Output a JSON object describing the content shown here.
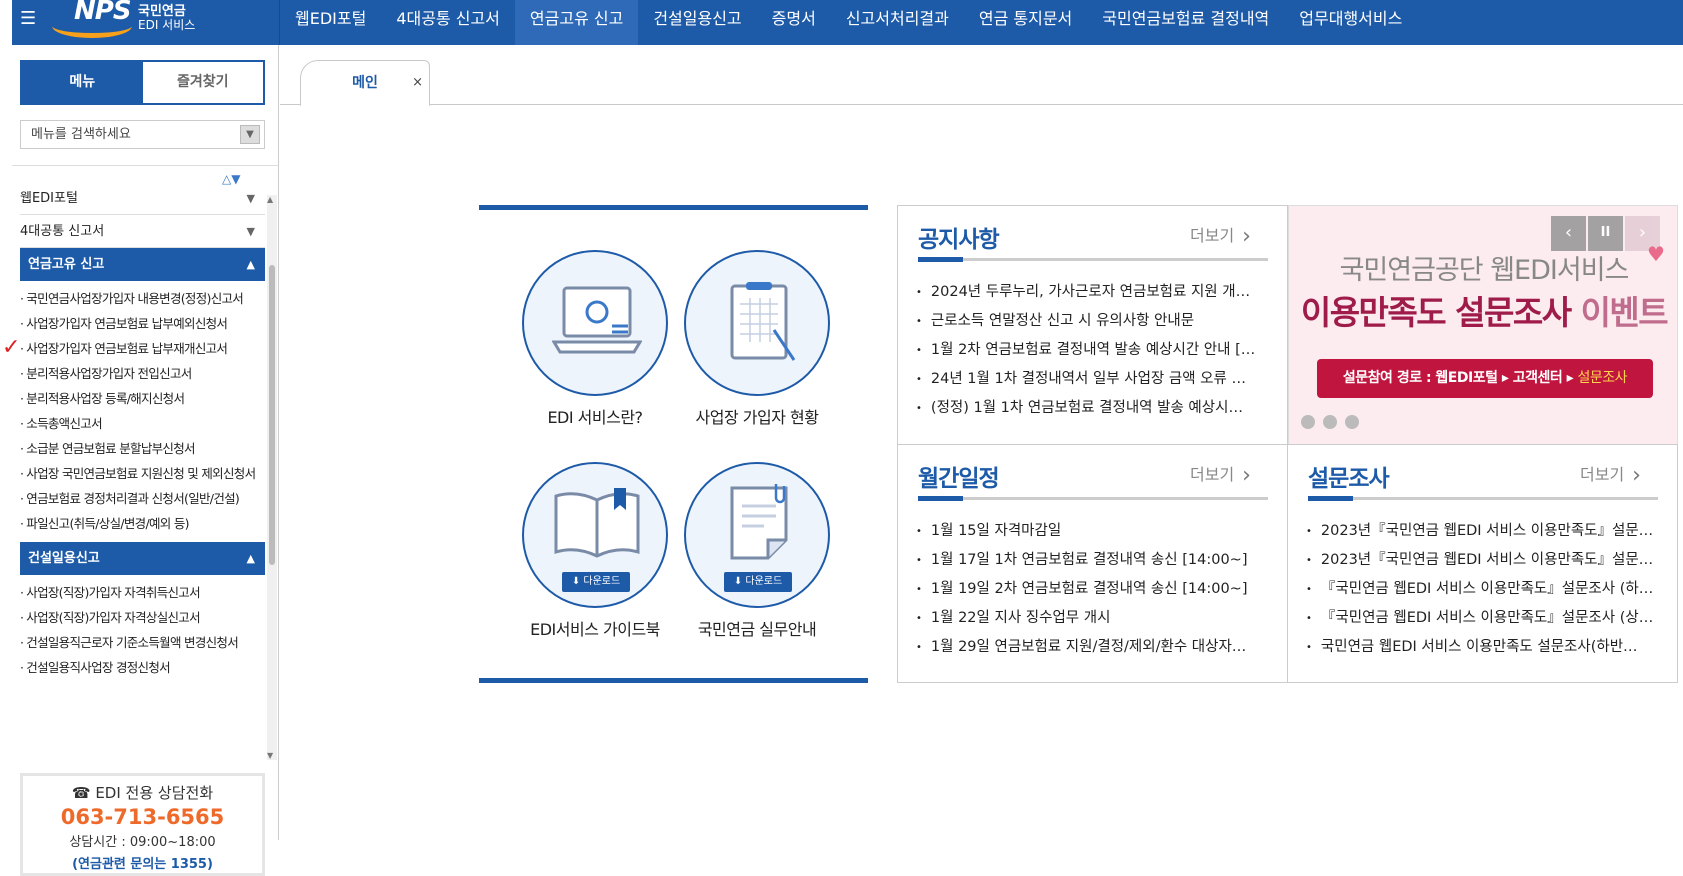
{
  "header": {
    "logo_main": "NPS",
    "logo_sub1": "국민연금",
    "logo_sub2": "EDI 서비스",
    "nav": [
      "웹EDI포털",
      "4대공통 신고서",
      "연금고유 신고",
      "건설일용신고",
      "증명서",
      "신고서처리결과",
      "연금 통지문서",
      "국민연금보험료 결정내역",
      "업무대행서비스"
    ],
    "active_nav_index": 2
  },
  "sidebar": {
    "tab_menu": "메뉴",
    "tab_favorites": "즐겨찾기",
    "search_placeholder": "메뉴를 검색하세요",
    "groups": [
      {
        "label": "웹EDI포털",
        "open": false
      },
      {
        "label": "4대공통 신고서",
        "open": false
      },
      {
        "label": "연금고유 신고",
        "open": true
      },
      {
        "label": "건설일용신고",
        "open": true
      }
    ],
    "pension_items": [
      "국민연금사업장가입자 내용변경(정정)신고서",
      "사업장가입자 연금보험료 납부예외신청서",
      "사업장가입자 연금보험료 납부재개신고서",
      "분리적용사업장가입자 전입신고서",
      "분리적용사업장 등록/해지신청서",
      "소득총액신고서",
      "소급분 연금보험료 분할납부신청서",
      "사업장 국민연금보험료 지원신청 및 제외신청서",
      "연금보험료 경정처리결과 신청서(일반/건설)",
      "파일신고(취득/상실/변경/예외 등)"
    ],
    "construction_items": [
      "사업장(직장)가입자 자격취득신고서",
      "사업장(직장)가입자 자격상실신고서",
      "건설일용직근로자 기준소득월액 변경신청서",
      "건설일용직사업장 경정신청서"
    ],
    "contact": {
      "title": "☎ EDI 전용 상담전화",
      "phone": "063-713-6565",
      "hours": "상담시간 : 09:00~18:00",
      "note": "(연금관련 문의는 1355)"
    }
  },
  "page_tab": {
    "label": "메인",
    "close": "×"
  },
  "services": [
    {
      "label": "EDI 서비스란?",
      "icon": "laptop-icon",
      "download": ""
    },
    {
      "label": "사업장 가입자 현황",
      "icon": "clipboard-icon",
      "download": ""
    },
    {
      "label": "EDI서비스 가이드북",
      "icon": "book-icon",
      "download": "다운로드"
    },
    {
      "label": "국민연금 실무안내",
      "icon": "document-icon",
      "download": "다운로드"
    }
  ],
  "notice": {
    "title": "공지사항",
    "more": "더보기",
    "items": [
      "2024년 두루누리, 가사근로자 연금보험료 지원 개…",
      "근로소득 연말정산 신고 시 유의사항 안내문",
      "1월 2차 연금보험료 결정내역 발송 예상시간 안내 […",
      "24년 1월 1차 결정내역서 일부 사업장 금액 오류 …",
      "(정정) 1월 1차 연금보험료 결정내역 발송 예상시…"
    ]
  },
  "banner": {
    "line1": "국민연금공단 웹EDI서비스",
    "line2a": "이용만족도 설문조사",
    "line2b": "이벤트",
    "button_a": "설문참여 경로 : 웹EDI포털 ▸ 고객센터 ▸ ",
    "button_b": "설문조사",
    "prev": "‹",
    "pause": "II",
    "next": "›"
  },
  "schedule": {
    "title": "월간일정",
    "more": "더보기",
    "items": [
      "1월 15일 자격마감일",
      "1월 17일 1차 연금보험료 결정내역 송신 [14:00~]",
      "1월 19일 2차 연금보험료 결정내역 송신 [14:00~]",
      "1월 22일 지사 징수업무 개시",
      "1월 29일 연금보험료 지원/결정/제외/환수 대상자…"
    ]
  },
  "survey": {
    "title": "설문조사",
    "more": "더보기",
    "items": [
      "2023년『국민연금 웹EDI 서비스 이용만족도』설문…",
      "2023년『국민연금 웹EDI 서비스 이용만족도』설문…",
      "『국민연금 웹EDI 서비스 이용만족도』설문조사 (하…",
      "『국민연금 웹EDI 서비스 이용만족도』설문조사 (상…",
      "국민연금 웹EDI 서비스 이용만족도 설문조사(하반…"
    ]
  },
  "colors": {
    "primary": "#1d5aa8",
    "accent": "#ee6a2a",
    "banner_button": "#c0153f"
  }
}
